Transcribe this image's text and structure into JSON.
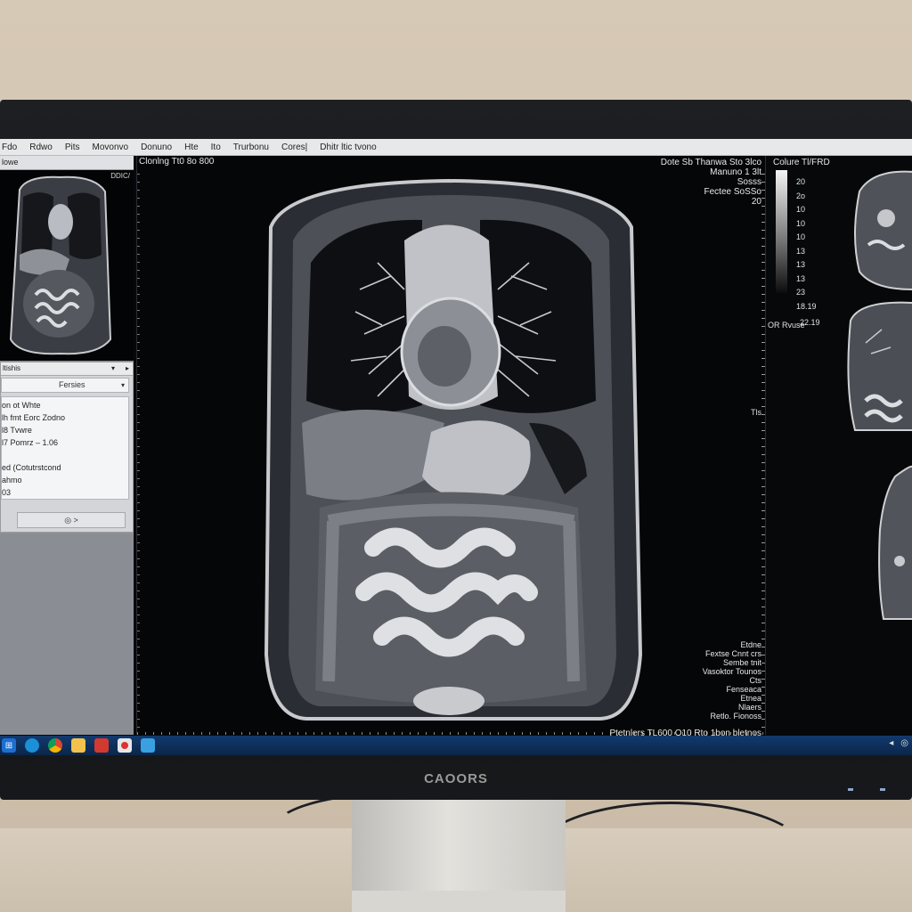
{
  "menu": {
    "items": [
      "Fdo",
      "Rdwo",
      "Pits",
      "Movonvo",
      "Donuno",
      "Hte",
      "Ito",
      "Trurbonu",
      "Cores|",
      "Dhitr ltic tvono"
    ]
  },
  "left_panel": {
    "title": "lowe",
    "thumbnail_label": "DDIC/",
    "props": {
      "header": "ltishis",
      "select_value": "Fersies",
      "items": [
        "on ot Whte",
        "lh fmt Eorc Zodno",
        "l8 Tvwre",
        "l7 Pomrz – 1.06",
        "",
        "ed (Cotutrstcond",
        "ahmo",
        "03"
      ],
      "button_label": "◎ >"
    }
  },
  "viewport": {
    "title": "Clonlng Tt0 8o 800",
    "top_mark": "",
    "info": [
      "Dote Sb Thanwa Sto 3lco",
      "Manuno 1 3lt",
      "Sosss",
      "Fectee SoSSo",
      "20"
    ],
    "bottom_info": [
      "Etdne",
      "Fextse Cnnt crs",
      "Sembe tnit",
      "Vasoktor Tounos",
      "Cts",
      "Fenseaca",
      "Etnea",
      "Nlaers",
      "Retlo. Fionoss"
    ],
    "bottom_label": "Ptetnlers TL600 O10 Rto 1bon bletnos",
    "right_mark": "Tls"
  },
  "right_panel": {
    "title": "Colure Tl/FRD",
    "colorbar_labels": [
      "20",
      "2o",
      "10",
      "10",
      "10",
      "13",
      "13",
      "13",
      "23",
      "18.19"
    ],
    "caption": "OR Rvuse",
    "value": "22.19"
  },
  "taskbar": {
    "icons": [
      "windows-icon",
      "edge-icon",
      "chrome-icon",
      "folder-icon",
      "app-icon",
      "recorder-icon",
      "viewer-icon"
    ],
    "tray": [
      "◂",
      "◎"
    ]
  },
  "monitor": {
    "brand": "CAOORS"
  }
}
